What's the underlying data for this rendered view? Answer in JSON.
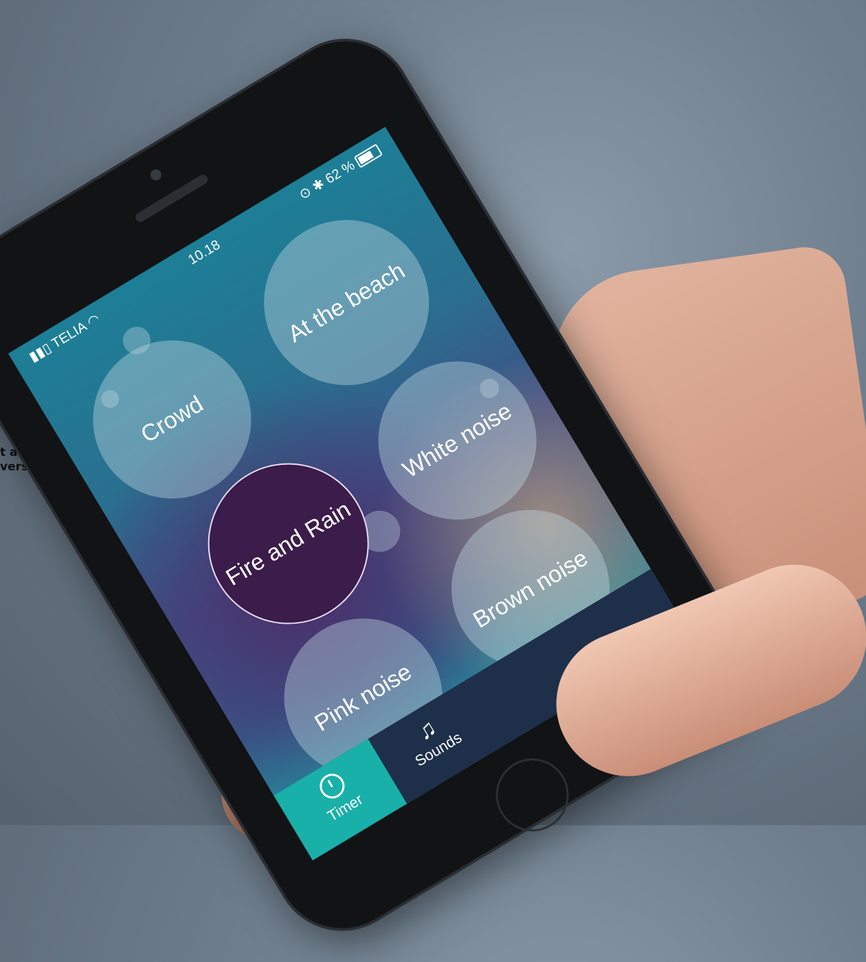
{
  "caption": {
    "line1": "t at bruge",
    "line2": "verskueligt"
  },
  "status": {
    "carrier": "TELIA",
    "time": "10.18",
    "battery": "62 %"
  },
  "bubbles": [
    {
      "label": "Crowd"
    },
    {
      "label": "At the beach"
    },
    {
      "label": "White noise"
    },
    {
      "label": "Fire and Rain"
    },
    {
      "label": "Brown noise"
    },
    {
      "label": "Pink noise"
    }
  ],
  "tabs": [
    {
      "label": "Timer",
      "icon": "timer-icon"
    },
    {
      "label": "Sounds",
      "icon": "music-note-icon"
    }
  ],
  "colors": {
    "selected_bubble": "#3b1c4a",
    "tab_active": "#19b0a9"
  }
}
